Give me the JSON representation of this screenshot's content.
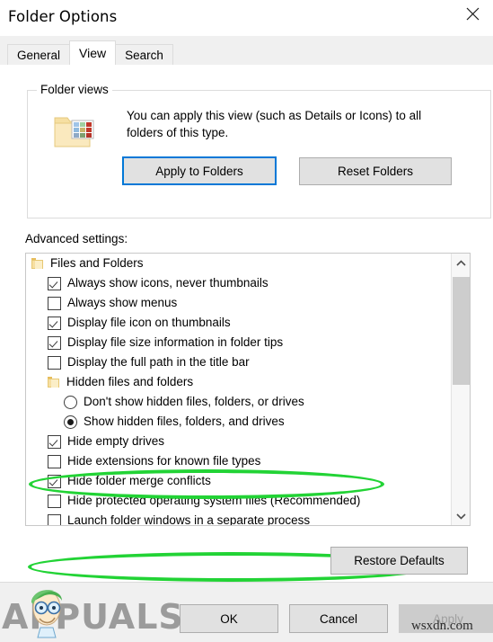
{
  "window": {
    "title": "Folder Options",
    "close_icon": "close-icon"
  },
  "tabs": [
    {
      "label": "General",
      "selected": false
    },
    {
      "label": "View",
      "selected": true
    },
    {
      "label": "Search",
      "selected": false
    }
  ],
  "folder_views": {
    "legend": "Folder views",
    "description": "You can apply this view (such as Details or Icons) to all folders of this type.",
    "apply_button": "Apply to Folders",
    "reset_button": "Reset Folders",
    "icon": "folder-views-icon",
    "focus_color": "#0078d7"
  },
  "advanced": {
    "label": "Advanced settings:",
    "rows": [
      {
        "kind": "group",
        "label": "Files and Folders",
        "control": "folder",
        "checked": false
      },
      {
        "kind": "item",
        "label": "Always show icons, never thumbnails",
        "control": "checkbox",
        "checked": true
      },
      {
        "kind": "item",
        "label": "Always show menus",
        "control": "checkbox",
        "checked": false
      },
      {
        "kind": "item",
        "label": "Display file icon on thumbnails",
        "control": "checkbox",
        "checked": true
      },
      {
        "kind": "item",
        "label": "Display file size information in folder tips",
        "control": "checkbox",
        "checked": true
      },
      {
        "kind": "item",
        "label": "Display the full path in the title bar",
        "control": "checkbox",
        "checked": false
      },
      {
        "kind": "subgroup",
        "label": "Hidden files and folders",
        "control": "folder",
        "checked": false
      },
      {
        "kind": "subitem",
        "label": "Don't show hidden files, folders, or drives",
        "control": "radio",
        "checked": false
      },
      {
        "kind": "subitem",
        "label": "Show hidden files, folders, and drives",
        "control": "radio",
        "checked": true
      },
      {
        "kind": "item",
        "label": "Hide empty drives",
        "control": "checkbox",
        "checked": true
      },
      {
        "kind": "item",
        "label": "Hide extensions for known file types",
        "control": "checkbox",
        "checked": false
      },
      {
        "kind": "item",
        "label": "Hide folder merge conflicts",
        "control": "checkbox",
        "checked": true
      },
      {
        "kind": "item",
        "label": "Hide protected operating system files (Recommended)",
        "control": "checkbox",
        "checked": false
      },
      {
        "kind": "item",
        "label": "Launch folder windows in a separate process",
        "control": "checkbox",
        "checked": false
      }
    ],
    "scrollbar": {
      "up_icon": "chevron-up-icon",
      "down_icon": "chevron-down-icon"
    }
  },
  "highlights": {
    "color": "#22d335",
    "annotated_rows": [
      "Show hidden files, folders, and drives",
      "Hide protected operating system files (Recommended)"
    ]
  },
  "restore_defaults_button": "Restore Defaults",
  "footer": {
    "ok": "OK",
    "cancel": "Cancel",
    "apply": "Apply",
    "apply_disabled": true
  },
  "watermarks": {
    "brand": "APPUALS",
    "site": "wsxdn.com"
  }
}
